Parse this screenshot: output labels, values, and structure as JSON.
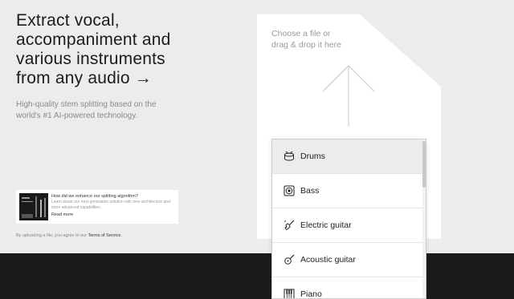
{
  "hero": {
    "title_lines": [
      "Extract vocal,",
      "accompaniment and",
      "various instruments",
      "from any audio →"
    ],
    "subtitle_lines": [
      "High-quality stem splitting based on the",
      "world's #1 AI-powered technology."
    ]
  },
  "promo": {
    "question": "How did we enhance our splitting algorithm?",
    "description": "Learn about our next generation solution with new architecture and more advanced capabilities.",
    "link": "Read more"
  },
  "terms": {
    "prefix": "By uploading a file, you agree to our",
    "link": "Terms of Service",
    "suffix": "."
  },
  "upload": {
    "line1": "Choose a file or",
    "line2": "drag & drop it here"
  },
  "dropdown": {
    "items": [
      {
        "label": "Drums",
        "icon": "drum-icon"
      },
      {
        "label": "Bass",
        "icon": "speaker-icon"
      },
      {
        "label": "Electric guitar",
        "icon": "electric-guitar-icon"
      },
      {
        "label": "Acoustic guitar",
        "icon": "acoustic-guitar-icon"
      },
      {
        "label": "Piano",
        "icon": "piano-icon"
      }
    ],
    "selected": "Drums"
  },
  "colors": {
    "background": "#ececec",
    "panel": "#ffffff",
    "dark_band": "#1a1a1a",
    "muted_text": "#9a9a9a"
  }
}
